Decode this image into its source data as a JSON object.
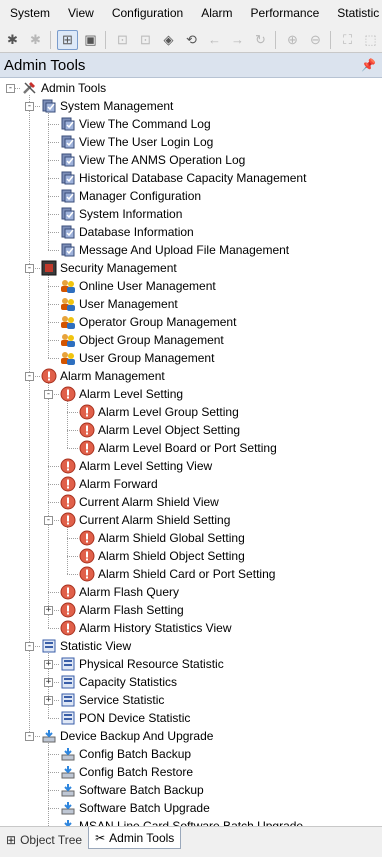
{
  "menu": [
    "System",
    "View",
    "Configuration",
    "Alarm",
    "Performance",
    "Statistic"
  ],
  "toolbar": [
    {
      "icon": "gear-alarm-icon",
      "glyph": "✱",
      "disabled": false
    },
    {
      "icon": "gear-disabled-icon",
      "glyph": "✱",
      "disabled": true
    },
    {
      "sep": true
    },
    {
      "icon": "topology-icon",
      "glyph": "⊞",
      "active": true
    },
    {
      "icon": "monitor-icon",
      "glyph": "▣",
      "disabled": false
    },
    {
      "sep": true
    },
    {
      "icon": "lock-icon",
      "glyph": "⊡",
      "disabled": true
    },
    {
      "icon": "lock-small-icon",
      "glyph": "⊡",
      "disabled": true
    },
    {
      "icon": "shield-icon",
      "glyph": "◈",
      "disabled": false
    },
    {
      "icon": "refresh-plus-icon",
      "glyph": "⟲",
      "disabled": false
    },
    {
      "icon": "back-arrow-icon",
      "glyph": "←",
      "disabled": true
    },
    {
      "icon": "forward-arrow-icon",
      "glyph": "→",
      "disabled": true
    },
    {
      "icon": "reload-icon",
      "glyph": "↻",
      "disabled": true
    },
    {
      "sep": true
    },
    {
      "icon": "zoom-in-icon",
      "glyph": "⊕",
      "disabled": true
    },
    {
      "icon": "zoom-out-icon",
      "glyph": "⊖",
      "disabled": true
    },
    {
      "sep": true
    },
    {
      "icon": "fit-window-icon",
      "glyph": "⛶",
      "disabled": true
    },
    {
      "icon": "select-area-icon",
      "glyph": "⬚",
      "disabled": true
    }
  ],
  "panel": {
    "title": "Admin Tools",
    "pin_glyph": "📌"
  },
  "tree": [
    {
      "level": 0,
      "label": "Admin Tools",
      "icon": "tools",
      "toggle": "-"
    },
    {
      "level": 1,
      "label": "System Management",
      "icon": "sys",
      "toggle": "-"
    },
    {
      "level": 2,
      "label": "View The Command Log",
      "icon": "sys"
    },
    {
      "level": 2,
      "label": "View The User Login Log",
      "icon": "sys"
    },
    {
      "level": 2,
      "label": "View The ANMS Operation Log",
      "icon": "sys"
    },
    {
      "level": 2,
      "label": "Historical Database Capacity Management",
      "icon": "sys"
    },
    {
      "level": 2,
      "label": "Manager Configuration",
      "icon": "sys"
    },
    {
      "level": 2,
      "label": "System Information",
      "icon": "sys"
    },
    {
      "level": 2,
      "label": "Database Information",
      "icon": "sys"
    },
    {
      "level": 2,
      "label": "Message And Upload File Management",
      "icon": "sys"
    },
    {
      "level": 1,
      "label": "Security Management",
      "icon": "security",
      "toggle": "-"
    },
    {
      "level": 2,
      "label": "Online User Management",
      "icon": "users"
    },
    {
      "level": 2,
      "label": "User Management",
      "icon": "users"
    },
    {
      "level": 2,
      "label": "Operator Group Management",
      "icon": "users"
    },
    {
      "level": 2,
      "label": "Object Group Management",
      "icon": "users"
    },
    {
      "level": 2,
      "label": "User Group Management",
      "icon": "users"
    },
    {
      "level": 1,
      "label": "Alarm Management",
      "icon": "alarm",
      "toggle": "-"
    },
    {
      "level": 2,
      "label": "Alarm Level Setting",
      "icon": "alarm",
      "toggle": "-"
    },
    {
      "level": 3,
      "label": "Alarm Level Group Setting",
      "icon": "alarm"
    },
    {
      "level": 3,
      "label": "Alarm Level Object Setting",
      "icon": "alarm"
    },
    {
      "level": 3,
      "label": "Alarm Level Board or Port Setting",
      "icon": "alarm"
    },
    {
      "level": 2,
      "label": "Alarm Level Setting View",
      "icon": "alarm"
    },
    {
      "level": 2,
      "label": "Alarm Forward",
      "icon": "alarm"
    },
    {
      "level": 2,
      "label": "Current Alarm Shield View",
      "icon": "alarm"
    },
    {
      "level": 2,
      "label": "Current Alarm Shield Setting",
      "icon": "alarm",
      "toggle": "-"
    },
    {
      "level": 3,
      "label": "Alarm Shield Global Setting",
      "icon": "alarm"
    },
    {
      "level": 3,
      "label": "Alarm Shield Object Setting",
      "icon": "alarm"
    },
    {
      "level": 3,
      "label": "Alarm Shield Card or Port Setting",
      "icon": "alarm"
    },
    {
      "level": 2,
      "label": "Alarm Flash Query",
      "icon": "alarm"
    },
    {
      "level": 2,
      "label": "Alarm Flash Setting",
      "icon": "alarm",
      "toggle": "+"
    },
    {
      "level": 2,
      "label": "Alarm History Statistics View",
      "icon": "alarm"
    },
    {
      "level": 1,
      "label": "Statistic View",
      "icon": "stat",
      "toggle": "-"
    },
    {
      "level": 2,
      "label": "Physical Resource Statistic",
      "icon": "stat",
      "toggle": "+"
    },
    {
      "level": 2,
      "label": "Capacity Statistics",
      "icon": "stat",
      "toggle": "+"
    },
    {
      "level": 2,
      "label": "Service Statistic",
      "icon": "stat",
      "toggle": "+"
    },
    {
      "level": 2,
      "label": "PON Device Statistic",
      "icon": "stat"
    },
    {
      "level": 1,
      "label": "Device Backup And Upgrade",
      "icon": "backup",
      "toggle": "-"
    },
    {
      "level": 2,
      "label": "Config Batch Backup",
      "icon": "backup"
    },
    {
      "level": 2,
      "label": "Config Batch Restore",
      "icon": "backup"
    },
    {
      "level": 2,
      "label": "Software Batch Backup",
      "icon": "backup"
    },
    {
      "level": 2,
      "label": "Software Batch Upgrade",
      "icon": "backup"
    },
    {
      "level": 2,
      "label": "MSAN Line Card Software Batch Upgrade",
      "icon": "backup"
    }
  ],
  "tabs": [
    {
      "label": "Object Tree",
      "icon": "object-tree-icon",
      "glyph": "⊞",
      "active": false
    },
    {
      "label": "Admin Tools",
      "icon": "admin-tools-icon",
      "glyph": "✂",
      "active": true
    }
  ]
}
